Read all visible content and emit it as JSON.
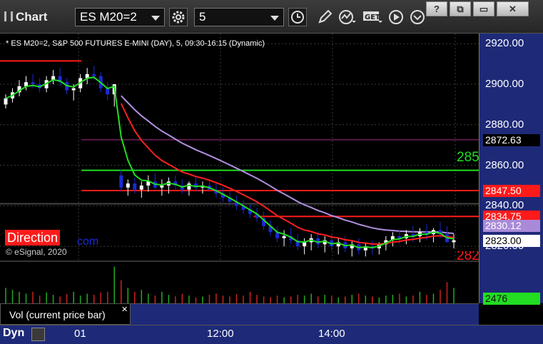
{
  "app": {
    "name": "Chart"
  },
  "toolbar": {
    "symbol": "ES M20=2",
    "interval": "5",
    "icons": [
      "gear-icon",
      "clock-icon",
      "pencil-icon",
      "study-icon",
      "get-icon",
      "play-icon"
    ],
    "window_buttons": [
      "?",
      "⧉",
      "▭",
      "✕"
    ]
  },
  "chart": {
    "header": "* ES M20=2, S&P 500 FUTURES E-MINI (DAY), 5, 09:30-16:15 (Dynamic)",
    "direction_label": "Direction",
    "partial_link": "com",
    "copyright": "© eSignal, 2020",
    "right_overlay_top": "285",
    "right_overlay_bottom": "282",
    "volume_label": "Vol (current price bar)",
    "close_glyph": "✕",
    "bottom_left_label": "Dyn",
    "colors": {
      "up_candle": "#ffffff",
      "down_candle": "#1a2bd4",
      "ema_fast": "#ff2020",
      "ema_green": "#22dd22",
      "vwap": "#b090e0",
      "bg": "#000000",
      "axis_bg": "#1e2a78"
    }
  },
  "chart_data": {
    "type": "candlestick",
    "title": "ES M20=2, S&P 500 FUTURES E-MINI (DAY), 5, 09:30-16:15 (Dynamic)",
    "y_ticks": [
      "2920.00",
      "2900.00",
      "2880.00",
      "2860.00",
      "2840.00",
      "2820.00"
    ],
    "x_ticks": [
      "01",
      "12:00",
      "14:00"
    ],
    "ylim": [
      2813,
      2925
    ],
    "price_labels": [
      {
        "value": "2872.63",
        "bg": "#000000",
        "fg": "#ffffff",
        "price": 2872.63
      },
      {
        "value": "2847.50",
        "bg": "#ff1a1a",
        "fg": "#ffffff",
        "price": 2847.5
      },
      {
        "value": "2834.75",
        "bg": "#ff1a1a",
        "fg": "#ffffff",
        "price": 2834.75
      },
      {
        "value": "2830.12",
        "bg": "#a98ad8",
        "fg": "#ffffff",
        "price": 2830.12
      },
      {
        "value": "2823.00",
        "bg": "#ffffff",
        "fg": "#000000",
        "price": 2823.0
      }
    ],
    "volume_label_value": "2476",
    "levels": [
      {
        "price": 2911.5,
        "color": "#ff1a1a",
        "range": [
          0,
          0.17
        ]
      },
      {
        "price": 2872.63,
        "color": "#5a1a4a",
        "range": [
          0.17,
          1
        ]
      },
      {
        "price": 2857.5,
        "color": "#22dd22",
        "range": [
          0.17,
          1
        ]
      },
      {
        "price": 2847.5,
        "color": "#ff1a1a",
        "range": [
          0.17,
          1
        ]
      },
      {
        "price": 2841,
        "color": "#444444",
        "range": [
          0,
          1
        ]
      },
      {
        "price": 2834.75,
        "color": "#ff1a1a",
        "range": [
          0.53,
          1
        ]
      }
    ],
    "candles": [
      [
        2890,
        2895,
        2888,
        2893
      ],
      [
        2893,
        2898,
        2891,
        2896
      ],
      [
        2896,
        2902,
        2894,
        2899
      ],
      [
        2899,
        2904,
        2897,
        2901
      ],
      [
        2901,
        2905,
        2898,
        2900
      ],
      [
        2900,
        2903,
        2896,
        2898
      ],
      [
        2898,
        2904,
        2896,
        2902
      ],
      [
        2902,
        2907,
        2900,
        2904
      ],
      [
        2904,
        2908,
        2899,
        2901
      ],
      [
        2901,
        2903,
        2895,
        2897
      ],
      [
        2897,
        2900,
        2892,
        2898
      ],
      [
        2898,
        2905,
        2896,
        2903
      ],
      [
        2903,
        2908,
        2900,
        2905
      ],
      [
        2905,
        2909,
        2902,
        2904
      ],
      [
        2904,
        2906,
        2896,
        2898
      ],
      [
        2898,
        2901,
        2892,
        2895
      ],
      [
        2895,
        2898,
        2889,
        2900
      ],
      [
        2855,
        2858,
        2847,
        2849
      ],
      [
        2849,
        2853,
        2845,
        2851
      ],
      [
        2851,
        2854,
        2846,
        2848
      ],
      [
        2848,
        2852,
        2844,
        2850
      ],
      [
        2850,
        2855,
        2847,
        2852
      ],
      [
        2852,
        2856,
        2848,
        2849
      ],
      [
        2849,
        2853,
        2845,
        2850
      ],
      [
        2850,
        2854,
        2846,
        2852
      ],
      [
        2852,
        2855,
        2848,
        2850
      ],
      [
        2850,
        2853,
        2846,
        2848
      ],
      [
        2848,
        2852,
        2845,
        2851
      ],
      [
        2851,
        2854,
        2847,
        2849
      ],
      [
        2849,
        2852,
        2846,
        2850
      ],
      [
        2850,
        2853,
        2847,
        2848
      ],
      [
        2848,
        2851,
        2844,
        2846
      ],
      [
        2846,
        2849,
        2842,
        2844
      ],
      [
        2844,
        2847,
        2840,
        2842
      ],
      [
        2842,
        2845,
        2838,
        2840
      ],
      [
        2840,
        2843,
        2836,
        2838
      ],
      [
        2838,
        2841,
        2834,
        2836
      ],
      [
        2836,
        2839,
        2832,
        2834
      ],
      [
        2834,
        2837,
        2828,
        2830
      ],
      [
        2830,
        2833,
        2825,
        2827
      ],
      [
        2827,
        2830,
        2822,
        2824
      ],
      [
        2824,
        2828,
        2820,
        2825
      ],
      [
        2825,
        2829,
        2821,
        2823
      ],
      [
        2823,
        2826,
        2818,
        2820
      ],
      [
        2820,
        2824,
        2816,
        2822
      ],
      [
        2822,
        2826,
        2818,
        2824
      ],
      [
        2824,
        2827,
        2819,
        2821
      ],
      [
        2821,
        2825,
        2817,
        2823
      ],
      [
        2823,
        2826,
        2818,
        2820
      ],
      [
        2820,
        2824,
        2816,
        2822
      ],
      [
        2822,
        2825,
        2817,
        2819
      ],
      [
        2819,
        2823,
        2815,
        2821
      ],
      [
        2821,
        2824,
        2816,
        2818
      ],
      [
        2818,
        2822,
        2815,
        2820
      ],
      [
        2820,
        2823,
        2816,
        2819
      ],
      [
        2819,
        2822,
        2816,
        2821
      ],
      [
        2821,
        2825,
        2818,
        2823
      ],
      [
        2823,
        2827,
        2820,
        2825
      ],
      [
        2825,
        2828,
        2821,
        2824
      ],
      [
        2824,
        2828,
        2821,
        2826
      ],
      [
        2826,
        2830,
        2822,
        2825
      ],
      [
        2825,
        2829,
        2822,
        2827
      ],
      [
        2827,
        2831,
        2823,
        2826
      ],
      [
        2826,
        2829,
        2822,
        2828
      ],
      [
        2828,
        2832,
        2824,
        2826
      ],
      [
        2826,
        2830,
        2823,
        2822
      ],
      [
        2822,
        2826,
        2819,
        2823
      ]
    ],
    "volume": [
      40,
      35,
      30,
      25,
      30,
      20,
      28,
      22,
      18,
      24,
      30,
      20,
      25,
      22,
      28,
      30,
      95,
      60,
      40,
      30,
      35,
      25,
      20,
      30,
      22,
      18,
      25,
      20,
      15,
      18,
      22,
      25,
      20,
      18,
      24,
      20,
      30,
      22,
      18,
      16,
      20,
      15,
      18,
      22,
      20,
      25,
      18,
      22,
      20,
      15,
      18,
      22,
      25,
      20,
      18,
      15,
      20,
      22,
      25,
      18,
      20,
      30,
      22,
      25,
      35,
      55,
      40
    ]
  }
}
